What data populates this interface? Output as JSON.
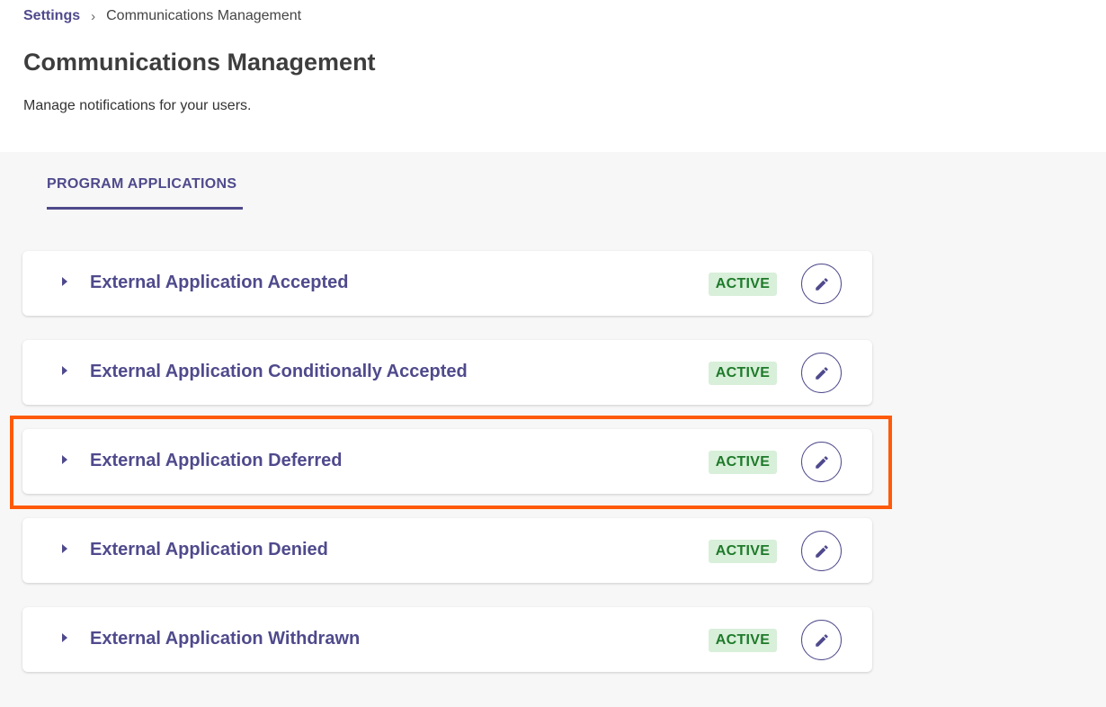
{
  "breadcrumb": {
    "root": "Settings",
    "separator": "›",
    "current": "Communications Management"
  },
  "page": {
    "title": "Communications Management",
    "subtitle": "Manage notifications for your users."
  },
  "tabs": [
    {
      "label": "PROGRAM APPLICATIONS",
      "active": true
    }
  ],
  "notifications": [
    {
      "title": "External Application Accepted",
      "status": "ACTIVE"
    },
    {
      "title": "External Application Conditionally Accepted",
      "status": "ACTIVE"
    },
    {
      "title": "External Application Deferred",
      "status": "ACTIVE",
      "highlighted": true
    },
    {
      "title": "External Application Denied",
      "status": "ACTIVE"
    },
    {
      "title": "External Application Withdrawn",
      "status": "ACTIVE"
    }
  ],
  "colors": {
    "accent": "#4f4a8c",
    "status_active_bg": "#d8efd9",
    "status_active_text": "#1e7a2a",
    "highlight": "#ff5a0a"
  }
}
